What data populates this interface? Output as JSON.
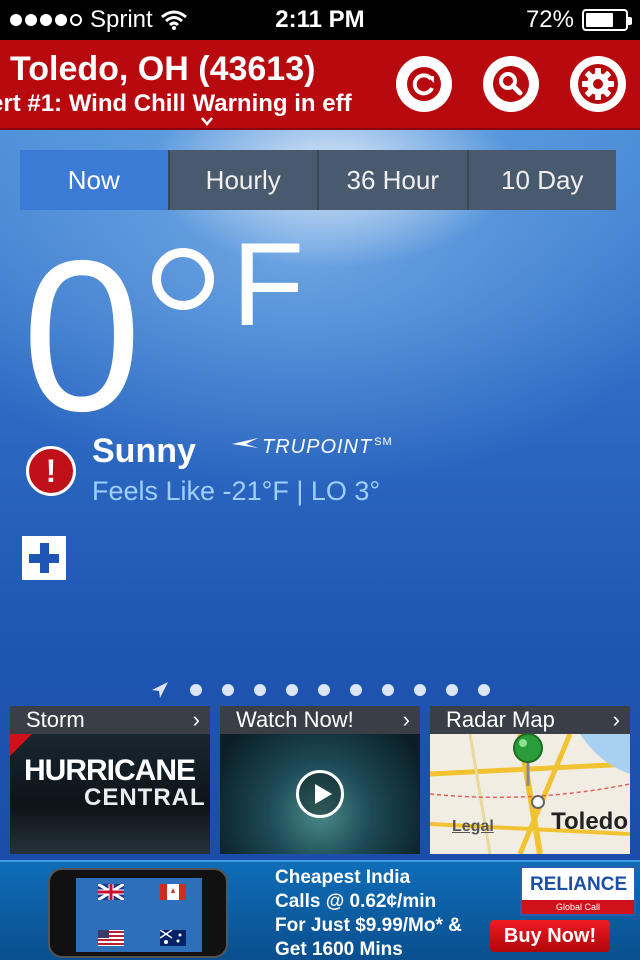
{
  "status_bar": {
    "carrier": "Sprint",
    "time": "2:11 PM",
    "battery": "72%",
    "battery_level": 0.72
  },
  "header": {
    "location": "Toledo, OH (43613)",
    "alert_ticker": "ert #1: Wind Chill Warning in eff"
  },
  "tabs": [
    {
      "label": "Now",
      "active": true
    },
    {
      "label": "Hourly",
      "active": false
    },
    {
      "label": "36 Hour",
      "active": false
    },
    {
      "label": "10 Day",
      "active": false
    }
  ],
  "current": {
    "temperature": "0",
    "unit": "F",
    "condition": "Sunny",
    "trupoint_logo": "TRUPOINT",
    "trupoint_mark": "SM",
    "feels_like": "Feels Like -21°F |  LO 3°"
  },
  "cards": [
    {
      "title": "Storm",
      "line1": "HURRICANE",
      "line2": "CENTRAL"
    },
    {
      "title": "Watch Now!"
    },
    {
      "title": "Radar Map",
      "legal": "Legal",
      "city": "Toledo"
    }
  ],
  "ad": {
    "line1": "Cheapest India",
    "line2": "Calls @ 0.62¢/min",
    "line3": "For Just $9.99/Mo* &",
    "line4": "Get 1600 Mins",
    "brand": "RELIANCE",
    "brand_sub": "Global Call",
    "button": "Buy Now!"
  },
  "colors": {
    "header_red": "#b8090f",
    "tab_active": "#3b7bd6",
    "feels_blue": "#9ed0ff"
  }
}
